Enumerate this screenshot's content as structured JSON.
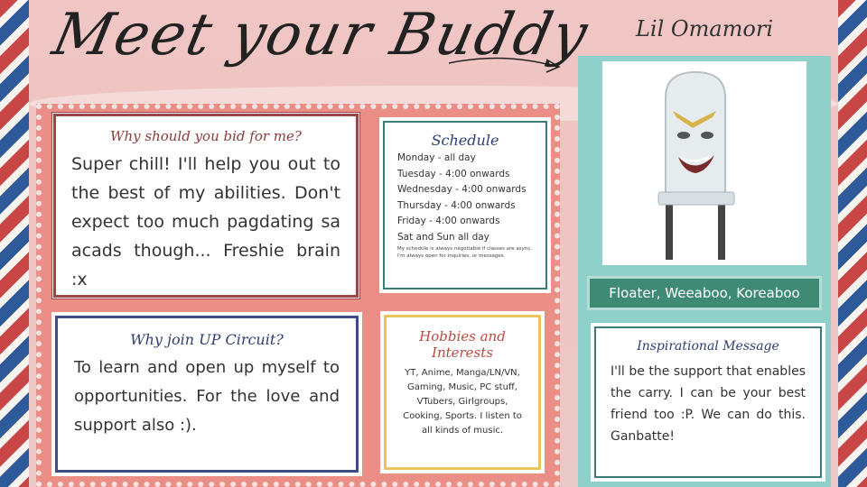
{
  "header": {
    "title": "Meet your Buddy",
    "name": "Lil Omamori"
  },
  "why_bid": {
    "heading": "Why should you bid for me?",
    "body": "Super chill! I'll help you out to the best of my abilities. Don't expect too much pagdating sa acads though... Freshie brain :x"
  },
  "schedule": {
    "heading": "Schedule",
    "lines": [
      "Monday  -  all day",
      "Tuesday  -  4:00 onwards",
      "Wednesday - 4:00 onwards",
      "Thursday  - 4:00 onwards",
      "Friday  - 4:00 onwards",
      "Sat and Sun all day"
    ],
    "note": "My schedule is always negotiable if classes are async. I'm always open for inquiries, or messages."
  },
  "why_join": {
    "heading": "Why join UP Circuit?",
    "body": "To learn and open up myself to opportunities. For the love and support also :)."
  },
  "hobbies": {
    "heading": "Hobbies and Interests",
    "body": "YT, Anime, Manga/LN/VN, Gaming, Music, PC stuff, VTubers, Girlgroups, Cooking, Sports. I listen to all kinds of music."
  },
  "tagline": "Floater, Weeaboo, Koreaboo",
  "inspirational": {
    "heading": "Inspirational Message",
    "body": "I'll be the support that enables the carry. I can be your best friend too :P. We can do this. Ganbatte!"
  },
  "colors": {
    "coral": "#ea8e86",
    "teal": "#8fd0cb",
    "dark_green": "#3f8a72",
    "navy": "#3b4b86",
    "maroon": "#9a4646",
    "mustard": "#e8c45c"
  },
  "image": {
    "subject": "led-with-face-illustration"
  }
}
